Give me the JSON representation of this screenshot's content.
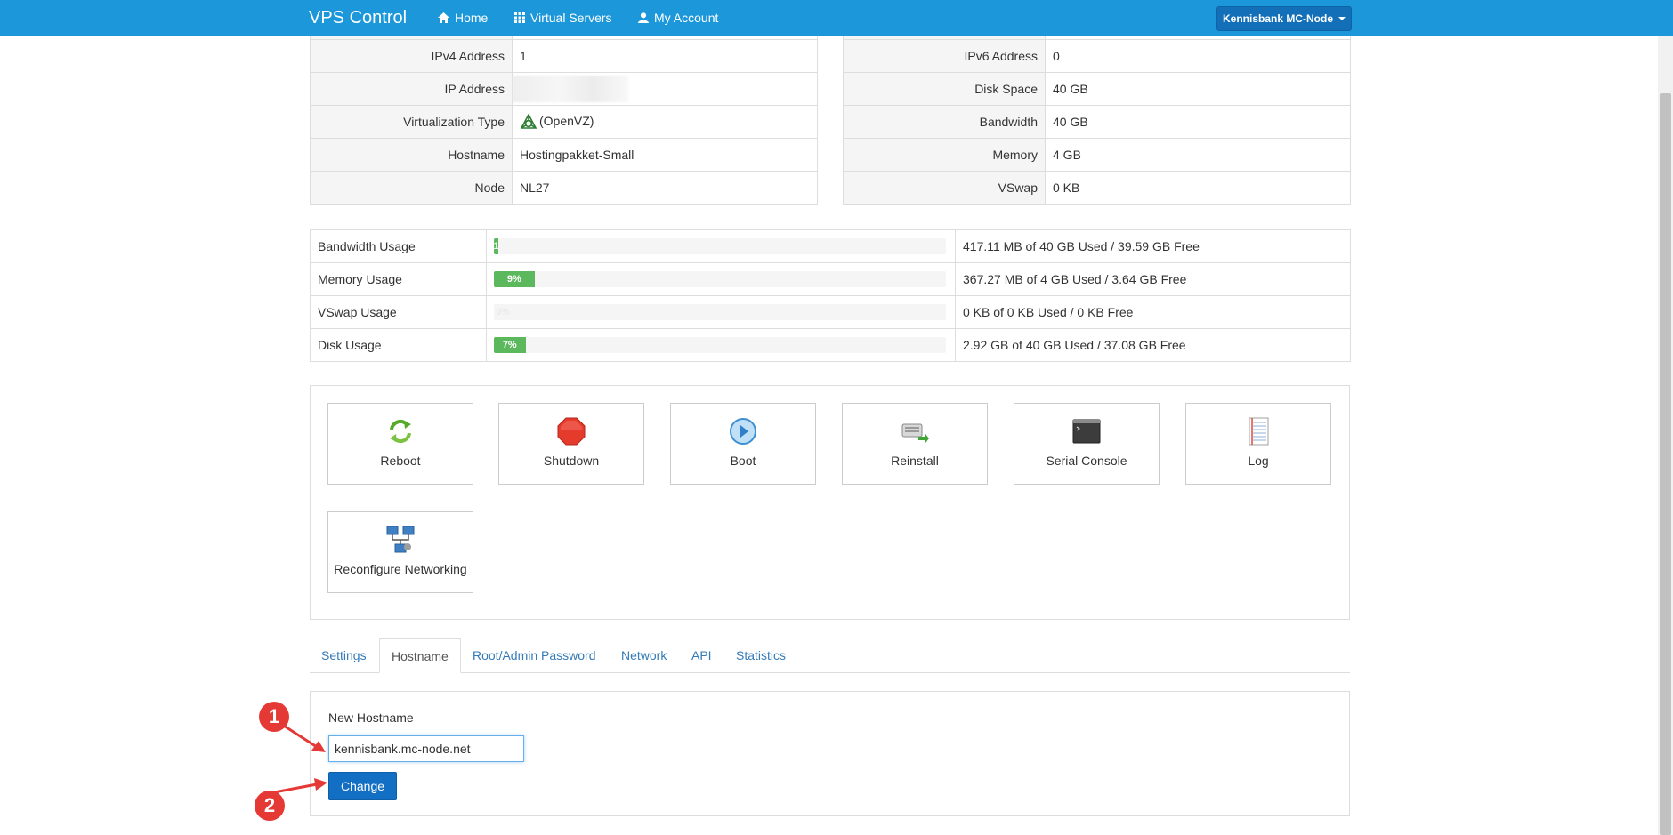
{
  "nav": {
    "brand": "VPS Control",
    "links": [
      {
        "label": "Home",
        "icon": "home-icon"
      },
      {
        "label": "Virtual Servers",
        "icon": "grid-icon"
      },
      {
        "label": "My Account",
        "icon": "user-icon"
      }
    ],
    "user_menu": "Kennisbank MC-Node"
  },
  "info_left": [
    {
      "label": "IPv4 Address",
      "value": "1"
    },
    {
      "label": "IP Address",
      "value": ""
    },
    {
      "label": "Virtualization Type",
      "value": "(OpenVZ)"
    },
    {
      "label": "Hostname",
      "value": "Hostingpakket-Small"
    },
    {
      "label": "Node",
      "value": "NL27"
    }
  ],
  "info_right": [
    {
      "label": "IPv6 Address",
      "value": "0"
    },
    {
      "label": "Disk Space",
      "value": "40 GB"
    },
    {
      "label": "Bandwidth",
      "value": "40 GB"
    },
    {
      "label": "Memory",
      "value": "4 GB"
    },
    {
      "label": "VSwap",
      "value": "0 KB"
    }
  ],
  "usage": [
    {
      "label": "Bandwidth Usage",
      "percent": 1,
      "bar_text": "1",
      "detail": "417.11 MB of 40 GB Used / 39.59 GB Free"
    },
    {
      "label": "Memory Usage",
      "percent": 9,
      "bar_text": "9%",
      "detail": "367.27 MB of 4 GB Used / 3.64 GB Free"
    },
    {
      "label": "VSwap Usage",
      "percent": 0,
      "bar_text": "0%",
      "detail": "0 KB of 0 KB Used / 0 KB Free"
    },
    {
      "label": "Disk Usage",
      "percent": 7,
      "bar_text": "7%",
      "detail": "2.92 GB of 40 GB Used / 37.08 GB Free"
    }
  ],
  "actions": [
    {
      "label": "Reboot",
      "icon": "reboot-icon"
    },
    {
      "label": "Shutdown",
      "icon": "shutdown-icon"
    },
    {
      "label": "Boot",
      "icon": "boot-icon"
    },
    {
      "label": "Reinstall",
      "icon": "reinstall-icon"
    },
    {
      "label": "Serial Console",
      "icon": "console-icon"
    },
    {
      "label": "Log",
      "icon": "log-icon"
    },
    {
      "label": "Reconfigure Networking",
      "icon": "network-icon"
    }
  ],
  "tabs": [
    "Settings",
    "Hostname",
    "Root/Admin Password",
    "Network",
    "API",
    "Statistics"
  ],
  "active_tab": "Hostname",
  "hostname_form": {
    "label": "New Hostname",
    "value": "kennisbank.mc-node.net",
    "button": "Change"
  },
  "annotations": [
    "1",
    "2"
  ],
  "colors": {
    "navbar": "#1b97da",
    "primary_button": "#136fc4",
    "progress": "#5cb85c",
    "annotation": "#e53935",
    "link": "#337ab7"
  }
}
